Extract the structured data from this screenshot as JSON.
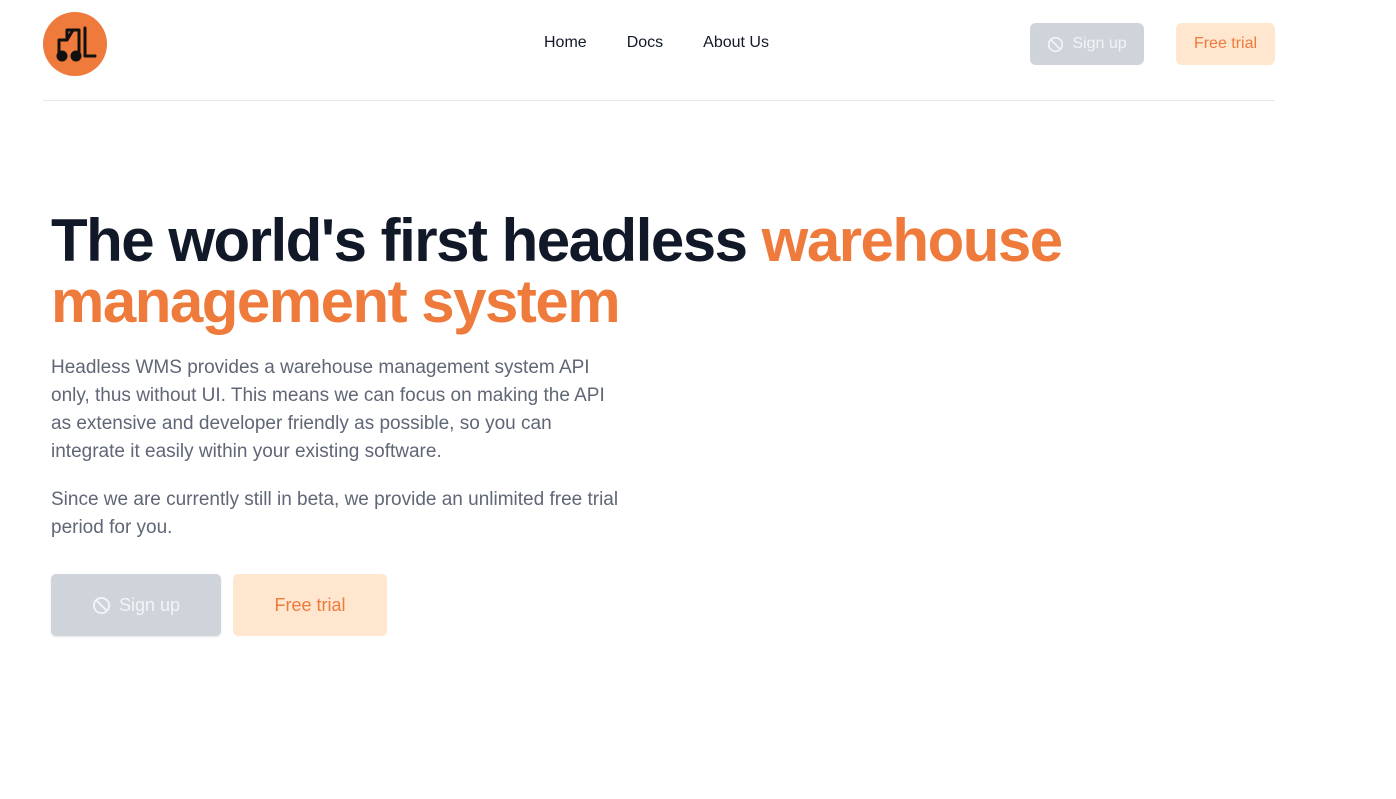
{
  "header": {
    "logo_icon": "forklift-icon",
    "nav": [
      {
        "label": "Home"
      },
      {
        "label": "Docs"
      },
      {
        "label": "About Us"
      }
    ],
    "signup_label": "Sign up",
    "signup_icon": "ban-icon",
    "trial_label": "Free trial"
  },
  "hero": {
    "headline_part1": "The world's first headless ",
    "headline_accent": "warehouse management system",
    "paragraph1": "Headless WMS provides a warehouse management system API only, thus without UI. This means we can focus on making the API as extensive and developer friendly as possible, so you can integrate it easily within your existing software.",
    "paragraph2": "Since we are currently still in beta, we provide an unlimited free trial period for you.",
    "signup_label": "Sign up",
    "trial_label": "Free trial"
  },
  "colors": {
    "accent": "#ee7a3c",
    "trial_bg": "#fee6cf",
    "disabled_bg": "#cfd3da",
    "heading": "#111827",
    "body_text": "#5f6675"
  }
}
